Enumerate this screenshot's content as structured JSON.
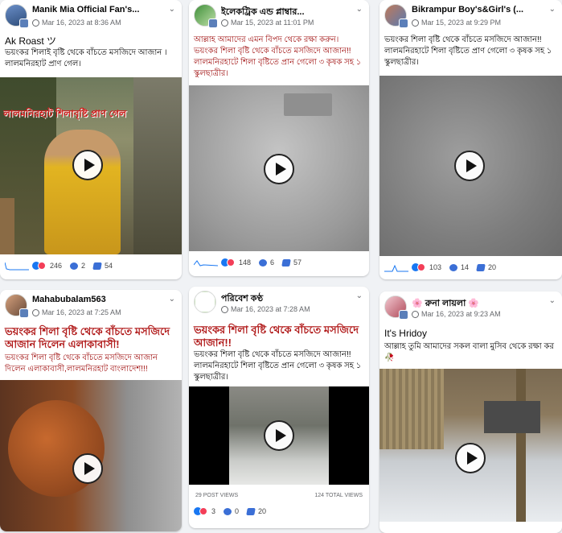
{
  "posts": [
    {
      "author": "Manik Mia Official Fan's...",
      "date": "Mar 16, 2023 at 8:36 AM",
      "title": "Ak Roast ツ",
      "text": "ভয়ংকর শিলাই বৃষ্টি থেকে বাঁচতে মসজিদে আজান ।লালমনিরহাট প্রাণ গেল।",
      "overlay_text": "লালমনিরহাট শিলাবৃষ্টি প্রাণ গেল",
      "reactions": "246",
      "comments": "2",
      "shares": "54"
    },
    {
      "author": "ইলেকট্রিক এন্ড প্লাম্বার...",
      "date": "Mar 15, 2023 at 11:01 PM",
      "text": "আল্লাহ আমাদের এমন বিপদ থেকে রক্ষা করুন। ভয়ংকর শিলা বৃষ্টি থেকে বাঁচতে মসজিদে আজান!! লালমনিরহাটে শিলা বৃষ্টিতে প্রান গেলো ৩ কৃষক সহ ১ স্কুলছাত্রীর।",
      "reactions": "148",
      "comments": "6",
      "shares": "57"
    },
    {
      "author": "Bikrampur Boy's&Girl's (...",
      "date": "Mar 15, 2023 at 9:29 PM",
      "text": "ভয়ংকর শিলা বৃষ্টি থেকে বাঁচতে মসজিদে আজান!! লালমনিরহাটে শিলা বৃষ্টিতে প্রাণ গেলো ৩ কৃষক সহ ১ স্কুলছাত্রীর।",
      "reactions": "103",
      "comments": "14",
      "shares": "20"
    },
    {
      "author": "Mahabubalam563",
      "date": "Mar 16, 2023 at 7:25 AM",
      "title": "ভয়ংকর শিলা বৃষ্টি থেকে বাঁচতে মসজিদে আজান দিলেন এলাকাবাসী!",
      "text": "ভয়ংকর শিলা বৃষ্টি থেকে বাঁচতে মসজিদে আজান দিলেন এলাকাবাসী,লালমনিরহাট বাংলাদেশ!!!"
    },
    {
      "author": "পরিবেশ কণ্ঠ",
      "date": "Mar 16, 2023 at 7:28 AM",
      "title": "ভয়ংকর শিলা বৃষ্টি থেকে বাঁচতে মসজিদে আজান!!",
      "text": "ভয়ংকর শিলা বৃষ্টি থেকে বাঁচতে মসজিদে আজান!! লালমনিরহাটে শিলা বৃষ্টিতে প্রান গেলো ৩ কৃষক সহ ১ স্কুলছাত্রীর।",
      "post_views": "29 POST VIEWS",
      "total_views": "124 TOTAL VIEWS",
      "reactions": "3",
      "comments": "0",
      "shares": "20"
    },
    {
      "author": "🌸 রুনা লায়লা 🌸",
      "date": "Mar 16, 2023 at 9:23 AM",
      "title": "It's Hridoy",
      "text": "আল্লাহ তুমি আমাদের সকল বালা মুসিব থেকে রক্ষা কর 🥀"
    }
  ],
  "colors": {
    "reaction_like": "#1877f2",
    "reaction_love": "#f33e58",
    "accent": "#1877f2"
  }
}
